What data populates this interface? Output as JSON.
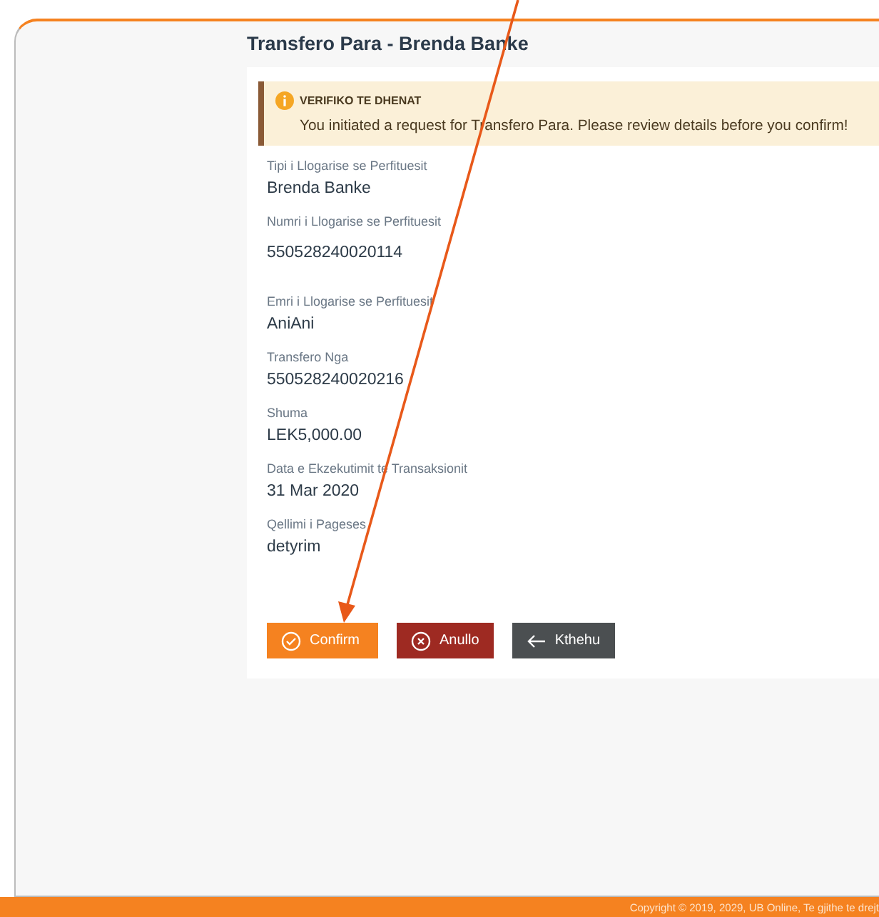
{
  "page_title": "Transfero Para - Brenda Banke",
  "alert": {
    "title": "VERIFIKO TE DHENAT",
    "message": "You initiated a request for Transfero Para. Please review details before you confirm!"
  },
  "fields": [
    {
      "label": "Tipi i Llogarise se Perfituesit",
      "value": "Brenda Banke"
    },
    {
      "label": "Numri i Llogarise se Perfituesit",
      "value": "550528240020114"
    },
    {
      "label": "Emri i Llogarise se Perfituesit",
      "value": "AniAni"
    },
    {
      "label": "Transfero Nga",
      "value": "550528240020216"
    },
    {
      "label": "Shuma",
      "value": "LEK5,000.00"
    },
    {
      "label": "Data e Ekzekutimit te Transaksionit",
      "value": "31 Mar 2020"
    },
    {
      "label": "Qellimi i Pageses",
      "value": "detyrim"
    }
  ],
  "buttons": [
    {
      "kind": "confirm",
      "label": "Confirm"
    },
    {
      "kind": "cancel",
      "label": "Anullo"
    },
    {
      "kind": "back",
      "label": "Kthehu"
    }
  ],
  "footer": "Copyright © 2019, 2029, UB Online, Te gjithe te drejt"
}
